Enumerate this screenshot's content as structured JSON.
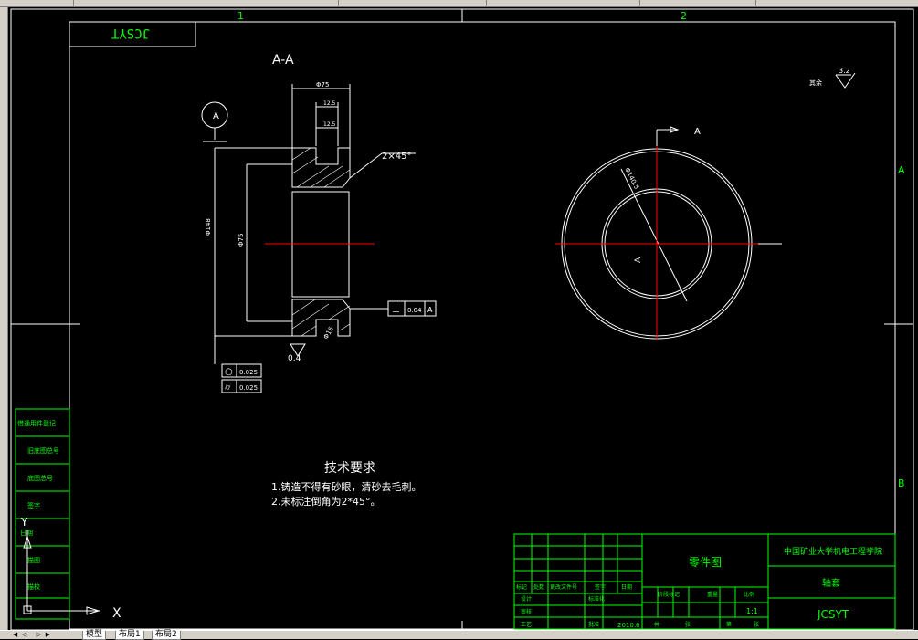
{
  "title_block_logo": "JCSYT",
  "zone_cols": [
    "1",
    "2"
  ],
  "zone_rows": [
    "A",
    "B"
  ],
  "section_title": "A-A",
  "section_marker": "A",
  "view_arrow_label": "A",
  "chamfer_note": "2×45°",
  "dims": {
    "top_outer": "Φ75",
    "top_inner": "12.5",
    "step": "12.5",
    "height_outer": "Φ148",
    "height_inner": "Φ75",
    "diag_circle": "Φ140.5",
    "bottom_side": "Φ16"
  },
  "roughness_main": "0.4",
  "roughness_corner": "3.2",
  "roughness_corner_label": "其余",
  "fcf_perp": {
    "symbol": "⊥",
    "value": "0.04",
    "datum": "A"
  },
  "fcf_round": {
    "symbol": "○",
    "value": "0.025"
  },
  "fcf_cyl": {
    "symbol": "⌭",
    "value": "0.025"
  },
  "tech_req": {
    "title": "技术要求",
    "lines": [
      "1.铸造不得有砂眼，清砂去毛刺。",
      "2.未标注倒角为2*45°。"
    ]
  },
  "left_table": [
    "借通用件登记",
    "旧底图总号",
    "底图总号",
    "签字",
    "日期",
    "描图",
    "描校"
  ],
  "title_block": {
    "drawing_type": "零件图",
    "school": "中国矿业大学机电工程学院",
    "part_name": "轴套",
    "logo": "JCSYT",
    "scale": "1:1",
    "labels": [
      "标记",
      "处数",
      "更改文件号",
      "签字",
      "日期",
      "设计",
      "标准化",
      "审核",
      "工艺",
      "批准",
      "阶段标记",
      "重量",
      "比例",
      "共",
      "张",
      "第",
      "张"
    ],
    "date_value": "2010.6"
  },
  "ucs": {
    "x_label": "X",
    "y_label": "Y"
  },
  "status_tabs": [
    "模型",
    "布局1",
    "布局2"
  ]
}
